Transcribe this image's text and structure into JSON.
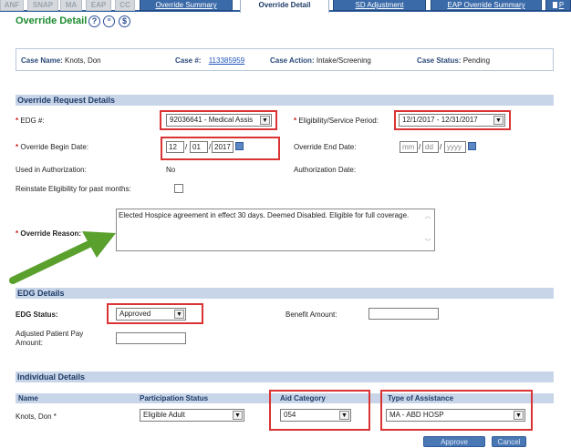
{
  "tabs": {
    "program": [
      "ANF",
      "SNAP",
      "MA",
      "EAP",
      "CC"
    ],
    "blue": [
      {
        "label": "Override Summary"
      },
      {
        "label": "Override Detail",
        "active": true
      },
      {
        "label": "SD Adjustment"
      },
      {
        "label": "EAP Override Summary"
      }
    ],
    "extra_label": "P"
  },
  "page": {
    "title": "Override Detail",
    "icons": [
      "help-icon",
      "notes-icon",
      "dollar-icon"
    ]
  },
  "case": {
    "name_label": "Case Name:",
    "name_value": "Knots, Don",
    "number_label": "Case #:",
    "number_value": "113385959",
    "action_label": "Case Action:",
    "action_value": "Intake/Screening",
    "status_label": "Case Status:",
    "status_value": "Pending"
  },
  "override": {
    "section_title": "Override Request Details",
    "edg_label": "EDG #:",
    "edg_value": "92036641 - Medical Assis",
    "period_label": "Eligibility/Service Period:",
    "period_value": "12/1/2017 - 12/31/2017",
    "begin_label": "Override Begin Date:",
    "begin_mm": "12",
    "begin_dd": "01",
    "begin_yyyy": "2017",
    "end_label": "Override End Date:",
    "end_mm": "mm",
    "end_dd": "dd",
    "end_yyyy": "yyyy",
    "used_label": "Used in Authorization:",
    "used_value": "No",
    "auth_label": "Authorization Date:",
    "reinstate_label": "Reinstate Eligibility for past months:",
    "reason_label": "Override Reason:",
    "reason_value": "Elected Hospice agreement in effect 30 days.  Deemed Disabled.  Eligible for full coverage."
  },
  "edg": {
    "section_title": "EDG Details",
    "status_label": "EDG Status:",
    "status_value": "Approved",
    "benefit_label": "Benefit Amount:",
    "benefit_value": "",
    "adjusted_label": "Adjusted Patient Pay Amount:",
    "adjusted_value": ""
  },
  "individual": {
    "section_title": "Individual Details",
    "columns": [
      "Name",
      "Participation Status",
      "Aid Category",
      "Type of Assistance"
    ],
    "row": {
      "name": "Knots, Don *",
      "participation": "Eligible Adult",
      "aid_category": "054",
      "assistance": "MA - ABD HOSP"
    }
  },
  "buttons": {
    "approve": "Approve",
    "cancel": "Cancel"
  },
  "colors": {
    "accent_green": "#1b8a2e",
    "tab_blue": "#3b6aa8",
    "section_blue": "#c8d5e8",
    "highlight_red": "#d93333",
    "arrow_green": "#5aa02c"
  }
}
